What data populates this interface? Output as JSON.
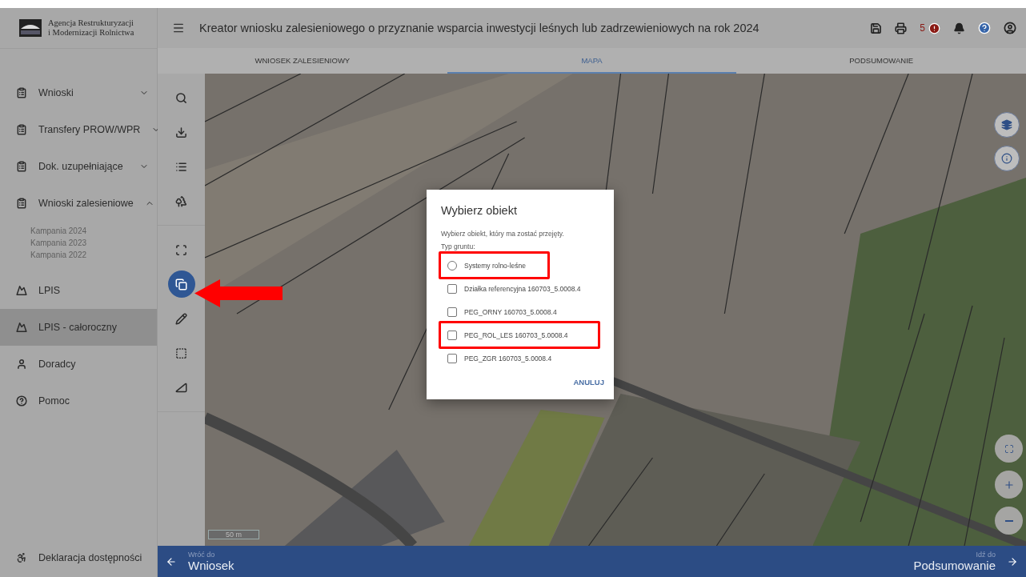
{
  "header": {
    "logo_lines": [
      "Agencja Restrukturyzacji",
      "i Modernizacji Rolnictwa"
    ],
    "title": "Kreator wniosku zalesieniowego o przyznanie wsparcia inwestycji leśnych lub zadrzewieniowych na rok 2024",
    "alert_count": "5"
  },
  "tabs": [
    {
      "label": "WNIOSEK ZALESIENIOWY",
      "selected": false
    },
    {
      "label": "MAPA",
      "selected": true
    },
    {
      "label": "PODSUMOWANIE",
      "selected": false
    }
  ],
  "sidebar": {
    "items": [
      {
        "kind": "group",
        "label": "Wnioski",
        "expanded": false,
        "selected": false
      },
      {
        "kind": "group",
        "label": "Transfery PROW/WPR",
        "expanded": false,
        "selected": false
      },
      {
        "kind": "group",
        "label": "Dok. uzupełniające",
        "expanded": false,
        "selected": false
      },
      {
        "kind": "group",
        "label": "Wnioski zalesieniowe",
        "expanded": true,
        "selected": false,
        "children": [
          {
            "label": "Kampania 2024"
          },
          {
            "label": "Kampania 2023"
          },
          {
            "label": "Kampania 2022"
          }
        ]
      },
      {
        "kind": "link",
        "label": "LPIS",
        "selected": false
      },
      {
        "kind": "link",
        "label": "LPIS - całoroczny",
        "selected": true
      },
      {
        "kind": "link",
        "label": "Doradcy",
        "selected": false
      },
      {
        "kind": "link",
        "label": "Pomoc",
        "selected": false
      }
    ],
    "footer_item": {
      "label": "Deklaracja dostępności"
    }
  },
  "toolbar": {
    "groups": [
      {
        "tools": [
          {
            "kind": "search",
            "selected": false
          },
          {
            "kind": "download",
            "selected": false
          },
          {
            "kind": "list",
            "selected": false
          },
          {
            "kind": "trees",
            "selected": false
          }
        ]
      },
      {
        "tools": [
          {
            "kind": "select",
            "selected": false
          },
          {
            "kind": "copy",
            "selected": true
          },
          {
            "kind": "pencil",
            "selected": false
          },
          {
            "kind": "rectangle",
            "selected": false
          },
          {
            "kind": "measure",
            "selected": false
          }
        ]
      }
    ]
  },
  "map": {
    "scale": "50 m"
  },
  "dialog": {
    "title": "Wybierz obiekt",
    "message": "Wybierz obiekt, który ma zostać przejęty.",
    "group_label": "Typ gruntu:",
    "options": [
      {
        "kind": "radio",
        "label": "Systemy rolno-leśne",
        "checked": false,
        "highlighted": true
      },
      {
        "kind": "checkbox",
        "label": "Działka referencyjna 160703_5.0008.4",
        "checked": false,
        "highlighted": false
      },
      {
        "kind": "checkbox",
        "label": "PEG_ORNY 160703_5.0008.4",
        "checked": false,
        "highlighted": false
      },
      {
        "kind": "checkbox",
        "label": "PEG_ROL_LES 160703_5.0008.4",
        "checked": false,
        "highlighted": true
      },
      {
        "kind": "checkbox",
        "label": "PEG_ZGR 160703_5.0008.4",
        "checked": false,
        "highlighted": false
      }
    ],
    "cancel": "ANULUJ"
  },
  "footer": {
    "back_caption": "Wróć do",
    "back_label": "Wniosek",
    "next_caption": "Idź do",
    "next_label": "Podsumowanie"
  }
}
